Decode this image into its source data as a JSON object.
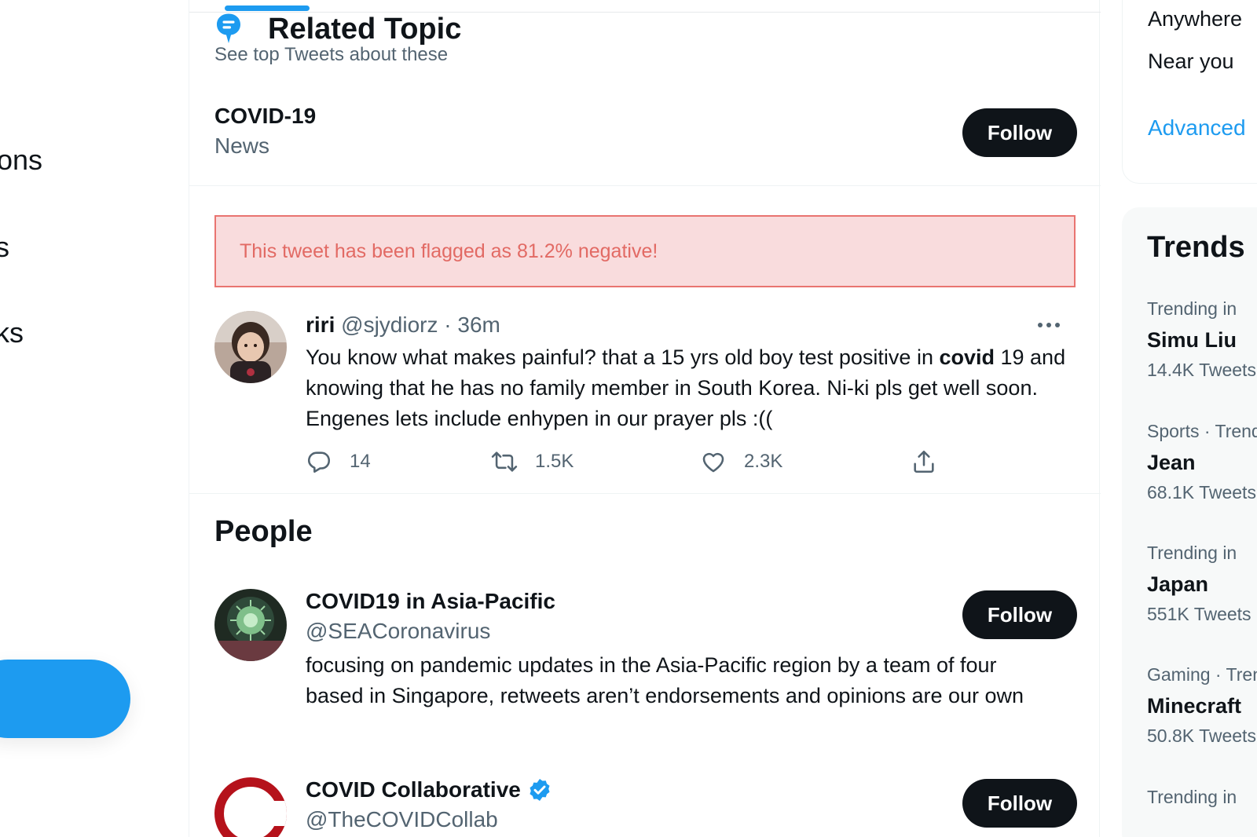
{
  "sidebar": {
    "items": [
      {
        "label": "ons"
      },
      {
        "label": "s"
      },
      {
        "label": "ks"
      }
    ]
  },
  "topic_section": {
    "title": "Related Topic",
    "subtitle": "See top Tweets about these",
    "topic": {
      "name": "COVID-19",
      "category": "News",
      "follow_label": "Follow"
    }
  },
  "flag": {
    "text": "This tweet has been flagged as 81.2% negative!",
    "bg_color": "#f9dcdd",
    "border_color": "#e97470"
  },
  "tweet": {
    "name": "riri",
    "handle": "@sjydiorz",
    "separator": "·",
    "time": "36m",
    "text_before": "You know what makes painful? that a 15 yrs old boy test positive in ",
    "text_bold": "covid",
    "text_after": " 19 and knowing that he has no family member in South Korea. Ni-ki pls get well soon. Engenes lets include enhypen in our prayer pls :((",
    "replies": "14",
    "retweets": "1.5K",
    "likes": "2.3K"
  },
  "people": {
    "title": "People",
    "items": [
      {
        "name": "COVID19 in Asia-Pacific",
        "handle": "@SEACoronavirus",
        "bio": "focusing on pandemic updates in the Asia-Pacific region by a team of four based in Singapore, retweets aren’t endorsements and opinions are our own",
        "follow_label": "Follow"
      },
      {
        "name": "COVID Collaborative",
        "handle": "@TheCOVIDCollab",
        "verified": true,
        "follow_label": "Follow"
      }
    ]
  },
  "right": {
    "location_options": [
      "Anywhere",
      "Near you"
    ],
    "advanced_link": "Advanced",
    "trends_title": "Trends",
    "trends": [
      {
        "context": "Trending in",
        "name": "Simu Liu",
        "count": "14.4K Tweets"
      },
      {
        "context": "Sports · Trending",
        "name": "Jean",
        "count": "68.1K Tweets"
      },
      {
        "context": "Trending in",
        "name": "Japan",
        "count": "551K Tweets"
      },
      {
        "context": "Gaming · Trending",
        "name": "Minecraft",
        "count": "50.8K Tweets"
      },
      {
        "context": "Trending in",
        "name": "",
        "count": ""
      }
    ]
  },
  "colors": {
    "accent": "#1d9bf0",
    "text": "#0f1419",
    "secondary": "#536471",
    "follow_bg": "#0f1419"
  },
  "icons": {
    "topic": "topic-bubble-icon",
    "more": "more-dots-icon",
    "reply": "reply-icon",
    "retweet": "retweet-icon",
    "like": "heart-icon",
    "share": "share-icon",
    "verified": "verified-badge-icon"
  }
}
